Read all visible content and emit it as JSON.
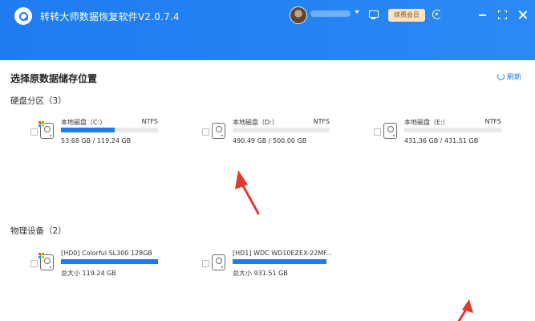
{
  "window": {
    "title": "转转大师数据恢复软件V2.0.7.4",
    "vip_label": "续费会员"
  },
  "page": {
    "title": "选择原数据储存位置",
    "refresh_label": "刷新"
  },
  "partitions": {
    "label": "硬盘分区（3）",
    "items": [
      {
        "name": "本地磁盘（C:）",
        "fs": "NTFS",
        "size": "53.68 GB / 119.24 GB",
        "used_fraction": 0.55,
        "windows": true
      },
      {
        "name": "本地磁盘（D:）",
        "fs": "NTFS",
        "size": "490.49 GB / 500.00 GB",
        "used_fraction": 0.0,
        "windows": false
      },
      {
        "name": "本地磁盘（E:）",
        "fs": "NTFS",
        "size": "431.36 GB / 431.51 GB",
        "used_fraction": 0.0,
        "windows": false
      }
    ]
  },
  "devices": {
    "label": "物理设备（2）",
    "items": [
      {
        "name": "[HD0] Colorful SL300 128GB",
        "size": "总大小 119.24 GB",
        "used_fraction": 1.0,
        "windows": true
      },
      {
        "name": "[HD1] WDC WD10EZEX-22MF...",
        "size": "总大小 931.51 GB",
        "used_fraction": 1.0,
        "windows": false
      }
    ]
  },
  "colors": {
    "accent": "#1e7cf0",
    "arrow": "#e03a2f"
  }
}
